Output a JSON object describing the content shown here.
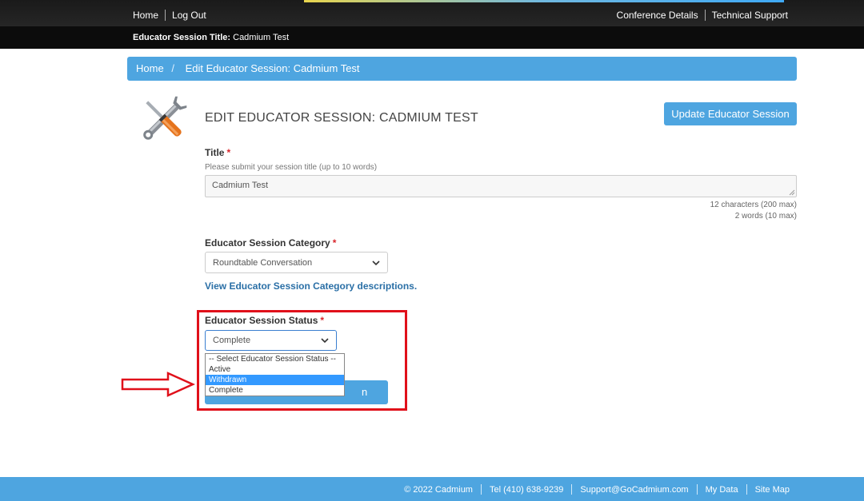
{
  "topnav": {
    "home": "Home",
    "logout": "Log Out",
    "conference_details": "Conference Details",
    "technical_support": "Technical Support"
  },
  "titlebar": {
    "label": "Educator Session Title:",
    "value": "Cadmium Test"
  },
  "breadcrumb": {
    "home": "Home",
    "separator": "/",
    "current": "Edit Educator Session: Cadmium Test"
  },
  "page": {
    "title": "EDIT EDUCATOR SESSION: CADMIUM TEST",
    "update_button": "Update Educator Session"
  },
  "form": {
    "required_marker": "*",
    "title": {
      "label": "Title",
      "help": "Please submit your session title (up to 10 words)",
      "value": "Cadmium Test",
      "char_count": "12 characters (200 max)",
      "word_count": "2 words (10 max)"
    },
    "category": {
      "label": "Educator Session Category",
      "selected": "Roundtable Conversation",
      "descriptions_link": "View Educator Session Category descriptions."
    },
    "status": {
      "label": "Educator Session Status",
      "selected": "Complete",
      "options": [
        "-- Select Educator Session Status --",
        "Active",
        "Withdrawn",
        "Complete"
      ],
      "highlighted_option": "Withdrawn",
      "obscured_button_fragment": "n"
    }
  },
  "footer": {
    "copyright": "© 2022 Cadmium",
    "tel": "Tel (410) 638-9239",
    "email": "Support@GoCadmium.com",
    "my_data": "My Data",
    "site_map": "Site Map"
  },
  "colors": {
    "accent_blue": "#4ea5e0",
    "annotation_red": "#e0101a",
    "dropdown_highlight": "#3399ff"
  }
}
